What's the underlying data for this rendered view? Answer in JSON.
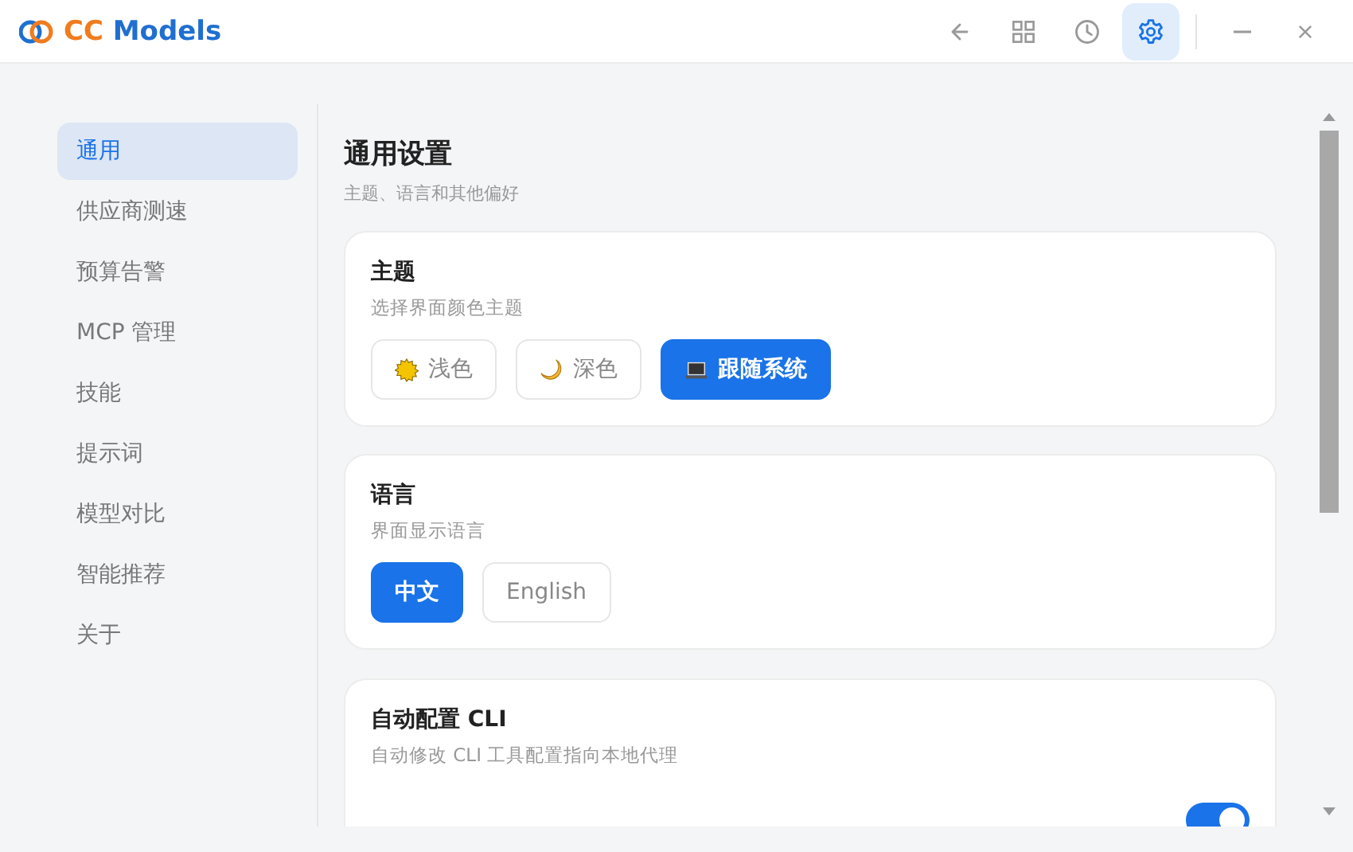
{
  "app": {
    "name_part_1": "CC",
    "name_part_2": "Models"
  },
  "toolbar": [
    {
      "kind": "back",
      "selected": false
    },
    {
      "kind": "grid",
      "selected": false
    },
    {
      "kind": "history",
      "selected": false
    },
    {
      "kind": "settings",
      "selected": true
    }
  ],
  "sidebar": {
    "items": [
      {
        "label": "通用",
        "selected": true
      },
      {
        "label": "供应商测速",
        "selected": false
      },
      {
        "label": "预算告警",
        "selected": false
      },
      {
        "label": "MCP 管理",
        "selected": false
      },
      {
        "label": "技能",
        "selected": false
      },
      {
        "label": "提示词",
        "selected": false
      },
      {
        "label": "模型对比",
        "selected": false
      },
      {
        "label": "智能推荐",
        "selected": false
      },
      {
        "label": "关于",
        "selected": false
      }
    ]
  },
  "page": {
    "title": "通用设置",
    "subtitle": "主题、语言和其他偏好"
  },
  "sections": [
    {
      "title": "主题",
      "description": "选择界面颜色主题",
      "options": [
        {
          "kind": "light",
          "label": "浅色",
          "selected": false
        },
        {
          "kind": "dark",
          "label": "深色",
          "selected": false
        },
        {
          "kind": "system",
          "label": "跟随系统",
          "selected": true
        }
      ]
    },
    {
      "title": "语言",
      "description": "界面显示语言",
      "options": [
        {
          "kind": "plain",
          "label": "中文",
          "selected": true
        },
        {
          "kind": "plain",
          "label": "English",
          "selected": false
        }
      ]
    },
    {
      "title": "自动配置 CLI",
      "description": "自动修改 CLI 工具配置指向本地代理",
      "toggle": {
        "on": true
      }
    }
  ]
}
